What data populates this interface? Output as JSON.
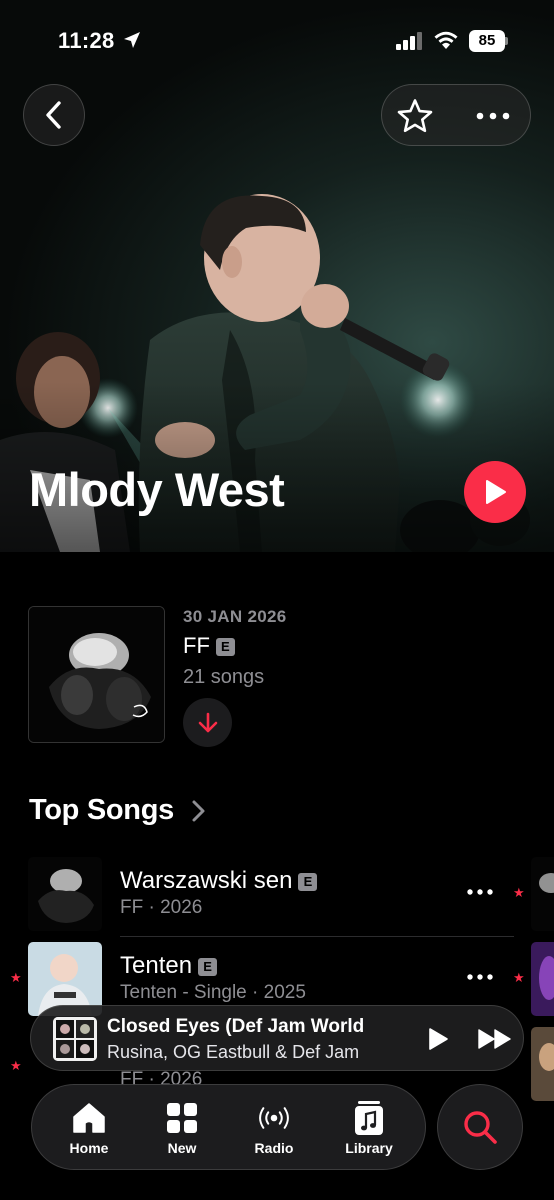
{
  "status_bar": {
    "time": "11:28",
    "battery": "85"
  },
  "artist": {
    "name": "Mlody West"
  },
  "latest_release": {
    "date": "30 JAN 2026",
    "title": "FF",
    "explicit_badge": "E",
    "song_count": "21 songs"
  },
  "top_songs": {
    "heading": "Top Songs",
    "songs": [
      {
        "title": "Warszawski sen",
        "explicit": "E",
        "subtitle": "FF · 2026"
      },
      {
        "title": "Tenten",
        "explicit": "E",
        "subtitle": "Tenten - Single · 2025"
      },
      {
        "title": "",
        "explicit": "",
        "subtitle": "FF · 2026"
      }
    ]
  },
  "now_playing": {
    "title": "Closed Eyes (Def Jam World",
    "artist": "Rusina, OG Eastbull & Def Jam"
  },
  "tabs": [
    {
      "label": "Home",
      "icon": "home-icon"
    },
    {
      "label": "New",
      "icon": "grid-icon"
    },
    {
      "label": "Radio",
      "icon": "radio-icon"
    },
    {
      "label": "Library",
      "icon": "library-icon"
    }
  ],
  "search": {
    "icon": "search-icon"
  },
  "colors": {
    "accent": "#fa2d48",
    "secondary_text": "#8e8e93",
    "background": "#000000"
  }
}
